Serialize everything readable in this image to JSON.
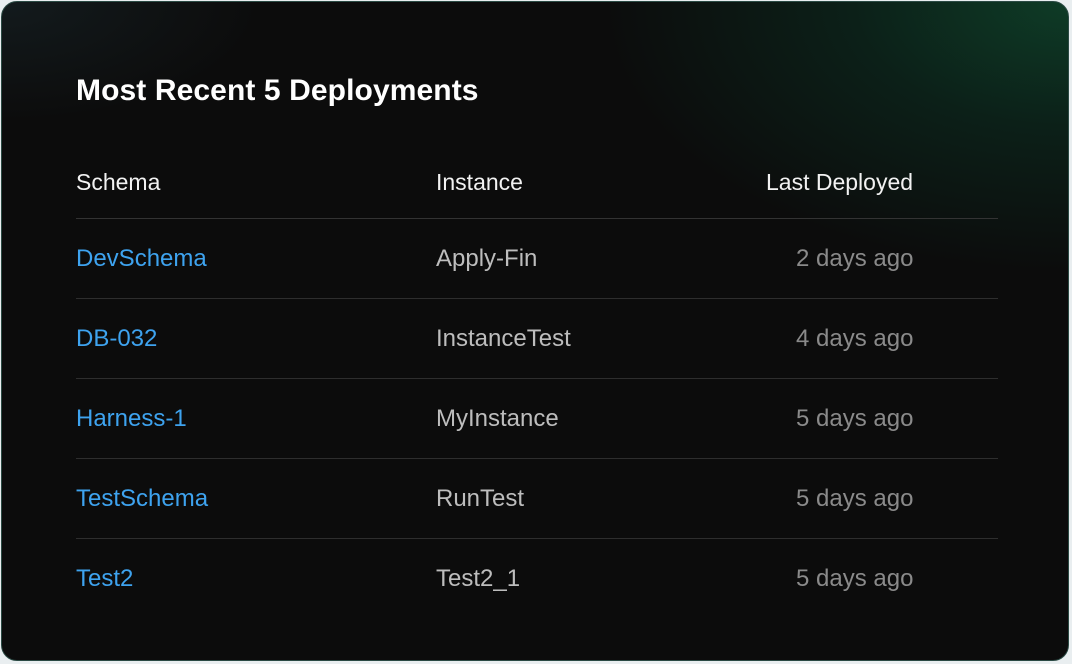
{
  "card": {
    "title": "Most Recent 5 Deployments"
  },
  "table": {
    "columns": {
      "schema": "Schema",
      "instance": "Instance",
      "last_deployed": "Last Deployed"
    },
    "rows": [
      {
        "schema": "DevSchema",
        "instance": "Apply-Fin",
        "last_deployed": "2 days ago"
      },
      {
        "schema": "DB-032",
        "instance": "InstanceTest",
        "last_deployed": "4 days ago"
      },
      {
        "schema": "Harness-1",
        "instance": "MyInstance",
        "last_deployed": "5 days ago"
      },
      {
        "schema": "TestSchema",
        "instance": "RunTest",
        "last_deployed": "5 days ago"
      },
      {
        "schema": "Test2",
        "instance": "Test2_1",
        "last_deployed": "5 days ago"
      }
    ]
  },
  "colors": {
    "link": "#3ea3ef",
    "background": "#0c0c0c",
    "accent_glow": "#0e3e28"
  }
}
